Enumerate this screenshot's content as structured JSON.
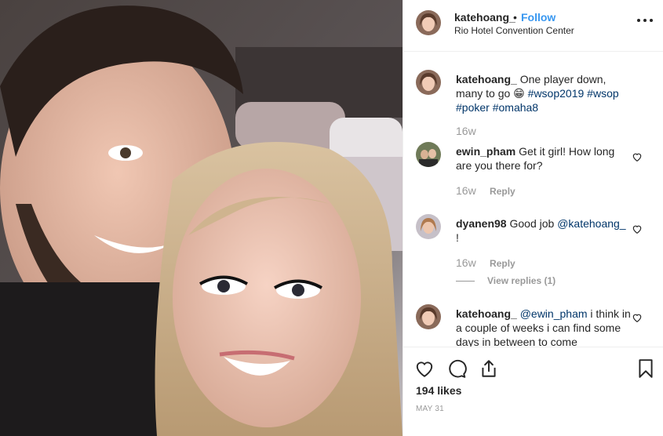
{
  "post": {
    "username": "katehoang_",
    "follow_label": "Follow",
    "separator": "•",
    "location": "Rio Hotel Convention Center",
    "likes": "194 likes",
    "date": "MAY 31"
  },
  "caption": {
    "username": "katehoang_",
    "text_before": "One player down, many to go",
    "emoji": "😁",
    "hashtags": [
      "#wsop2019",
      "#wsop",
      "#poker",
      "#omaha8"
    ],
    "age": "16w"
  },
  "comments": [
    {
      "username": "ewin_pham",
      "text": "Get it girl! How long are you there for?",
      "age": "16w",
      "reply_label": "Reply"
    },
    {
      "username": "dyanen98",
      "text_before": "Good job",
      "mention": "@katehoang_",
      "text_after": "!",
      "age": "16w",
      "reply_label": "Reply",
      "view_replies": "View replies (1)"
    },
    {
      "username": "katehoang_",
      "mention": "@ewin_pham",
      "text_after": "i think in a couple of weeks i can find some days in between to come"
    }
  ],
  "icons": {
    "more": "more-options-icon",
    "like": "heart-icon",
    "comment": "comment-icon",
    "share": "share-icon",
    "save": "bookmark-icon",
    "comment_like": "small-heart-icon"
  },
  "colors": {
    "accent": "#3897f0",
    "hashtag": "#003569",
    "muted": "#999999",
    "text": "#262626"
  }
}
